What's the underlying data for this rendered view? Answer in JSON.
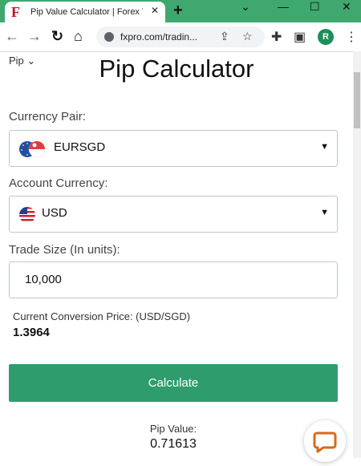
{
  "browser": {
    "tab_title": "Pip Value Calculator | Forex Tr",
    "tab_favicon": "F",
    "tab_close": "✕",
    "new_tab": "+",
    "url": "fxpro.com/tradin...",
    "avatar_letter": "R",
    "icons": [
      "back-arrow-icon",
      "forward-arrow-icon",
      "reload-icon",
      "home-icon",
      "lock-icon",
      "share-icon",
      "star-icon",
      "extensions-icon",
      "sidebar-icon",
      "menu-icon"
    ]
  },
  "page": {
    "pip_menu_label": "Pip",
    "title": "Pip Calculator",
    "currency_pair_label": "Currency Pair:",
    "currency_pair_value": "EURSGD",
    "account_currency_label": "Account Currency:",
    "account_currency_value": "USD",
    "trade_size_label": "Trade Size (In units):",
    "trade_size_value": "10,000",
    "conversion_label": "Current Conversion Price: (USD/SGD)",
    "conversion_value": "1.3964",
    "calculate_label": "Calculate",
    "pip_value_label": "Pip Value:",
    "pip_value": "0.71613"
  },
  "colors": {
    "chrome": "#3fa86f",
    "button": "#2f9c6e",
    "chat_icon": "#d46a1c"
  }
}
